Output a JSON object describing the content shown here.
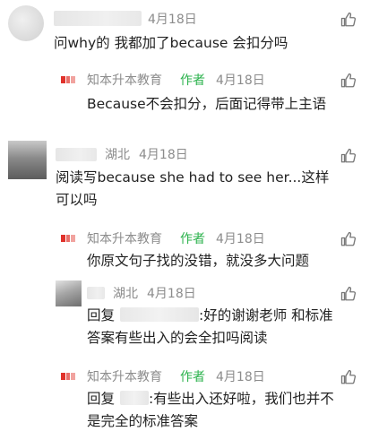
{
  "comments": [
    {
      "date": "4月18日",
      "text": "问why的 我都加了because 会扣分吗",
      "reply": {
        "author": "知本升本教育",
        "tag": "作者",
        "date": "4月18日",
        "text": "Because不会扣分，后面记得带上主语"
      }
    },
    {
      "location": "湖北",
      "date": "4月18日",
      "text_line1": "阅读写because she had to see her...这样",
      "text_line2": "可以吗",
      "replies": [
        {
          "author": "知本升本教育",
          "tag": "作者",
          "date": "4月18日",
          "text": "你原文句子找的没错，就没多大问题"
        },
        {
          "location": "湖北",
          "date": "4月18日",
          "reply_prefix": "回复",
          "text_line1": ":好的谢谢老师  和标准",
          "text_line2": "答案有些出入的会全扣吗阅读"
        },
        {
          "author": "知本升本教育",
          "tag": "作者",
          "date": "4月18日",
          "reply_prefix": "回复",
          "text_line1": ":有些出入还好啦，我们也并不",
          "text_line2": "是完全的标准答案"
        }
      ]
    }
  ],
  "icons": {
    "like": "thumbs-up-icon",
    "logo": "brand-logo-icon"
  },
  "colors": {
    "author_tag": "#2bb24c",
    "meta": "#8c8c8c",
    "logo_red": "#e0322b"
  }
}
